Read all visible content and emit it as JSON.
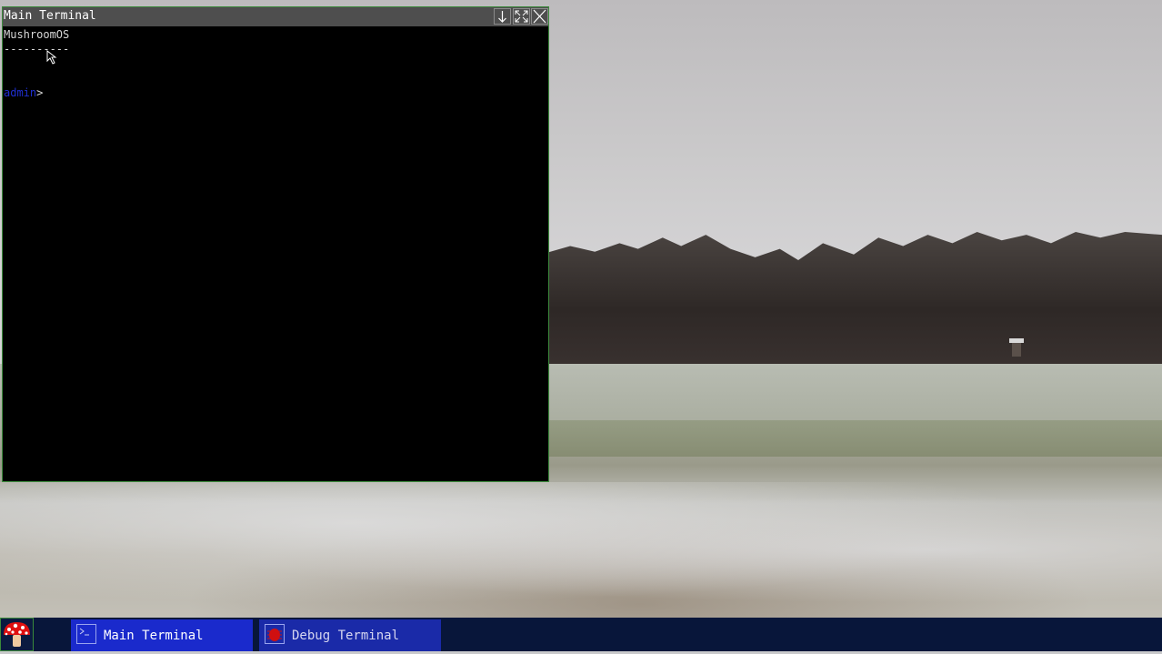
{
  "desktop": {
    "wallpaper": "snowy-field-photo"
  },
  "window": {
    "title": "Main Terminal",
    "buttons": {
      "minimize_icon": "arrow-down-icon",
      "maximize_icon": "expand-icon",
      "close_icon": "close-icon"
    },
    "lines": [
      "MushroomOS",
      "----------",
      "",
      ""
    ],
    "prompt_user": "admin",
    "prompt_symbol": ">",
    "accent_border": "#3c8a3c"
  },
  "taskbar": {
    "start_icon": "mushroom-icon",
    "tasks": [
      {
        "label": "Main Terminal",
        "icon": "terminal-icon",
        "active": true
      },
      {
        "label": "Debug Terminal",
        "icon": "bug-icon",
        "active": false
      }
    ],
    "colors": {
      "bar": "#08163a",
      "task_active": "#1a2acc"
    }
  }
}
